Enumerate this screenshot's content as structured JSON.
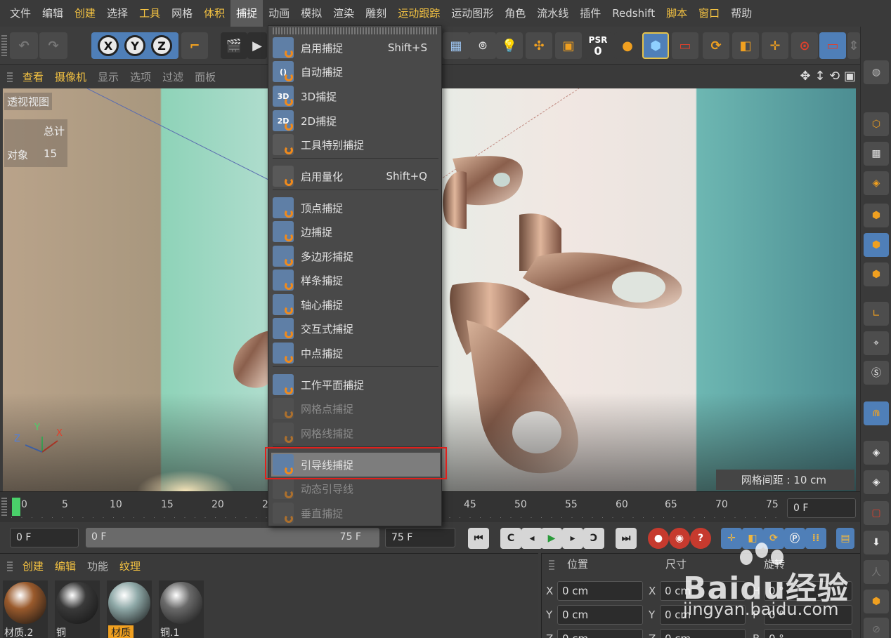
{
  "menubar": {
    "items": [
      {
        "label": "文件",
        "style": "normal"
      },
      {
        "label": "编辑",
        "style": "normal"
      },
      {
        "label": "创建",
        "style": "highlight"
      },
      {
        "label": "选择",
        "style": "normal"
      },
      {
        "label": "工具",
        "style": "highlight"
      },
      {
        "label": "网格",
        "style": "normal"
      },
      {
        "label": "体积",
        "style": "highlight"
      },
      {
        "label": "捕捉",
        "style": "open"
      },
      {
        "label": "动画",
        "style": "normal"
      },
      {
        "label": "模拟",
        "style": "normal"
      },
      {
        "label": "渲染",
        "style": "normal"
      },
      {
        "label": "雕刻",
        "style": "normal"
      },
      {
        "label": "运动跟踪",
        "style": "highlight"
      },
      {
        "label": "运动图形",
        "style": "normal"
      },
      {
        "label": "角色",
        "style": "normal"
      },
      {
        "label": "流水线",
        "style": "normal"
      },
      {
        "label": "插件",
        "style": "normal"
      },
      {
        "label": "Redshift",
        "style": "normal"
      },
      {
        "label": "脚本",
        "style": "highlight"
      },
      {
        "label": "窗口",
        "style": "highlight"
      },
      {
        "label": "帮助",
        "style": "normal"
      }
    ]
  },
  "toolbar": {
    "axis_x": "X",
    "axis_y": "Y",
    "axis_z": "Z",
    "psr_label": "PSR",
    "psr_value": "0"
  },
  "viewport_header": {
    "items": [
      {
        "label": "查看",
        "style": "highlight"
      },
      {
        "label": "摄像机",
        "style": "highlight"
      },
      {
        "label": "显示",
        "style": "normal"
      },
      {
        "label": "选项",
        "style": "normal"
      },
      {
        "label": "过滤",
        "style": "normal"
      },
      {
        "label": "面板",
        "style": "normal"
      }
    ]
  },
  "viewport": {
    "view_name": "透视视图",
    "stats_header": "总计",
    "stats_label": "对象",
    "stats_value": "15",
    "grid_spacing": "网格间距 : 10 cm",
    "axis_x": "X",
    "axis_y": "Y",
    "axis_z": "Z"
  },
  "snap_menu": {
    "items": [
      {
        "label": "启用捕捉",
        "shortcut": "Shift+S",
        "icon": "magnet-icon",
        "badge": "",
        "state": "normal"
      },
      {
        "label": "自动捕捉",
        "shortcut": "",
        "icon": "auto-snap-icon",
        "badge": "()",
        "state": "normal"
      },
      {
        "label": "3D捕捉",
        "shortcut": "",
        "icon": "snap-3d-icon",
        "badge": "3D",
        "state": "normal"
      },
      {
        "label": "2D捕捉",
        "shortcut": "",
        "icon": "snap-2d-icon",
        "badge": "2D",
        "state": "normal"
      },
      {
        "label": "工具特别捕捉",
        "shortcut": "",
        "icon": "tool-snap-icon",
        "badge": "",
        "state": "normal"
      },
      {
        "label": "启用量化",
        "shortcut": "Shift+Q",
        "icon": "quantize-icon",
        "badge": "",
        "state": "normal"
      },
      {
        "label": "顶点捕捉",
        "shortcut": "",
        "icon": "vertex-snap-icon",
        "badge": "",
        "state": "normal"
      },
      {
        "label": "边捕捉",
        "shortcut": "",
        "icon": "edge-snap-icon",
        "badge": "",
        "state": "normal"
      },
      {
        "label": "多边形捕捉",
        "shortcut": "",
        "icon": "polygon-snap-icon",
        "badge": "",
        "state": "normal"
      },
      {
        "label": "样条捕捉",
        "shortcut": "",
        "icon": "spline-snap-icon",
        "badge": "",
        "state": "normal"
      },
      {
        "label": "轴心捕捉",
        "shortcut": "",
        "icon": "axis-snap-icon",
        "badge": "",
        "state": "normal"
      },
      {
        "label": "交互式捕捉",
        "shortcut": "",
        "icon": "intersection-snap-icon",
        "badge": "",
        "state": "normal"
      },
      {
        "label": "中点捕捉",
        "shortcut": "",
        "icon": "midpoint-snap-icon",
        "badge": "",
        "state": "normal"
      },
      {
        "label": "工作平面捕捉",
        "shortcut": "",
        "icon": "workplane-snap-icon",
        "badge": "",
        "state": "normal"
      },
      {
        "label": "网格点捕捉",
        "shortcut": "",
        "icon": "grid-point-snap-icon",
        "badge": "",
        "state": "disabled"
      },
      {
        "label": "网格线捕捉",
        "shortcut": "",
        "icon": "grid-line-snap-icon",
        "badge": "",
        "state": "disabled"
      },
      {
        "label": "引导线捕捉",
        "shortcut": "",
        "icon": "guide-snap-icon",
        "badge": "",
        "state": "hot"
      },
      {
        "label": "动态引导线",
        "shortcut": "",
        "icon": "dynamic-guide-icon",
        "badge": "",
        "state": "disabled"
      },
      {
        "label": "垂直捕捉",
        "shortcut": "",
        "icon": "perpendicular-snap-icon",
        "badge": "",
        "state": "disabled"
      }
    ]
  },
  "timeline": {
    "ticks": [
      "0",
      "5",
      "10",
      "15",
      "20",
      "2",
      "45",
      "50",
      "55",
      "60",
      "65",
      "70",
      "75"
    ],
    "current_frame": "0 F"
  },
  "transport": {
    "start_field": "0 F",
    "range_start": "0 F",
    "range_end": "75 F",
    "end_field": "75 F"
  },
  "materials": {
    "tabs": [
      {
        "label": "创建",
        "style": "highlight"
      },
      {
        "label": "编辑",
        "style": "highlight"
      },
      {
        "label": "功能",
        "style": "normal"
      },
      {
        "label": "纹理",
        "style": "highlight"
      }
    ],
    "items": [
      {
        "name": "材质.2",
        "selected": false,
        "color": "#9a5a2c"
      },
      {
        "name": "铜",
        "selected": false,
        "color": "#3a3a3a"
      },
      {
        "name": "材质",
        "selected": true,
        "color": "#8fa9a8"
      },
      {
        "name": "铜.1",
        "selected": false,
        "color": "#6a6a6a"
      }
    ]
  },
  "attributes": {
    "head_position": "位置",
    "head_size": "尺寸",
    "head_rotation": "旋转",
    "rows": [
      {
        "label": "X",
        "pos": "0 cm",
        "size_label": "X",
        "size": "0 cm",
        "rot_label": "H",
        "rot": "0 °"
      },
      {
        "label": "Y",
        "pos": "0 cm",
        "size_label": "Y",
        "size": "0 cm",
        "rot_label": "P",
        "rot": "0 °"
      },
      {
        "label": "Z",
        "pos": "0 cm",
        "size_label": "Z",
        "size": "0 cm",
        "rot_label": "B",
        "rot": "0 °"
      }
    ]
  },
  "watermark": {
    "brand": "Baidu经验",
    "url": "jingyan.baidu.com"
  }
}
